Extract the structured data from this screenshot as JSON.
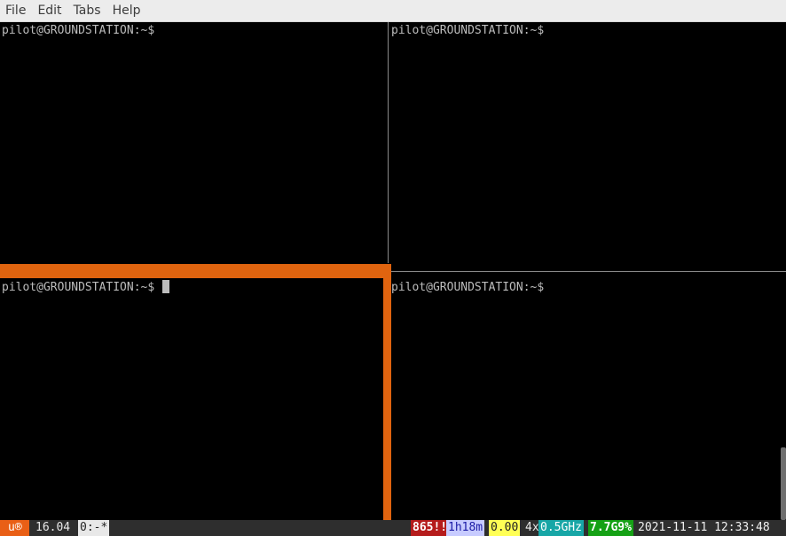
{
  "menubar": {
    "items": [
      "File",
      "Edit",
      "Tabs",
      "Help"
    ]
  },
  "panes": {
    "top_left": {
      "prompt": "pilot@GROUNDSTATION:~$"
    },
    "top_right": {
      "prompt": "pilot@GROUNDSTATION:~$"
    },
    "bottom_left": {
      "prompt": "pilot@GROUNDSTATION:~$ "
    },
    "bottom_right": {
      "prompt": "pilot@GROUNDSTATION:~$"
    }
  },
  "statusbar": {
    "logo": "u®",
    "version": "16.04",
    "window": "0:-*",
    "updates": "865!!",
    "uptime": "1h18m",
    "load": "0.00",
    "cpu_count": "4x",
    "cpu_freq": "0.5GHz",
    "memory": "7.7G9%",
    "datetime": "2021-11-11 12:33:48"
  },
  "colors": {
    "active_pane_border": "#e0640f",
    "terminal_bg": "#000000",
    "text": "#bdbdbd",
    "ubuntu_orange": "#e95f16"
  }
}
